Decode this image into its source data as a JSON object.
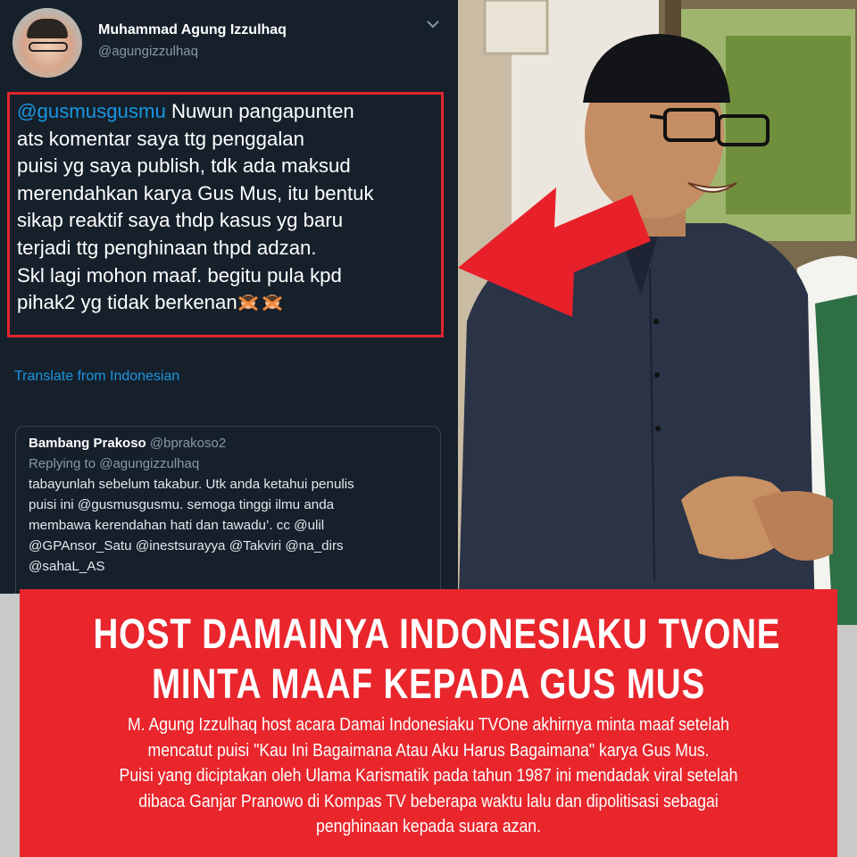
{
  "tweet": {
    "user_name": "Muhammad Agung Izzulhaq",
    "user_handle": "@agungizzulhaq",
    "mention": "@gusmusgusmu",
    "text_first": " Nuwun pangapunten",
    "lines": [
      "ats komentar saya ttg penggalan",
      "puisi yg saya publish, tdk ada maksud",
      "merendahkan karya Gus Mus, itu bentuk",
      "sikap reaktif saya thdp kasus yg baru",
      "terjadi ttg penghinaan thpd adzan.",
      "Skl lagi mohon maaf. begitu pula kpd",
      "pihak2 yg tidak berkenan"
    ],
    "translate_label": "Translate from Indonesian"
  },
  "quoted_tweet": {
    "name": "Bambang Prakoso",
    "handle": "@bprakoso2",
    "replying_to": "Replying to @agungizzulhaq",
    "lines": [
      "tabayunlah sebelum takabur. Utk anda ketahui penulis",
      "puisi ini @gusmusgusmu. semoga tinggi ilmu anda",
      "membawa kerendahan hati dan tawadu’. cc @ulil",
      "@GPAnsor_Satu @inestsurayya @Takviri @na_dirs",
      "@sahaL_AS"
    ]
  },
  "headline": {
    "line1": "HOST DAMAINYA INDONESIAKU TVONE",
    "line2": "MINTA MAAF KEPADA GUS MUS",
    "body": [
      "M. Agung Izzulhaq host acara Damai Indonesiaku TVOne akhirnya minta maaf setelah",
      "mencatut puisi \"Kau Ini Bagaimana Atau Aku Harus Bagaimana\" karya  Gus Mus.",
      "Puisi yang diciptakan oleh Ulama Karismatik pada tahun 1987 ini mendadak viral setelah",
      "dibaca Ganjar Pranowo di Kompas TV beberapa waktu lalu dan dipolitisasi sebagai",
      "penghinaan kepada suara azan."
    ]
  },
  "colors": {
    "twitter_bg": "#15202b",
    "link_blue": "#1b95e0",
    "highlight_red": "#e0242e",
    "banner_red": "#e8262c"
  },
  "icons": {
    "chevron": "chevron-down-icon",
    "emoji": "person-gesturing-no-emoji",
    "arrow": "red-arrow-graphic"
  }
}
